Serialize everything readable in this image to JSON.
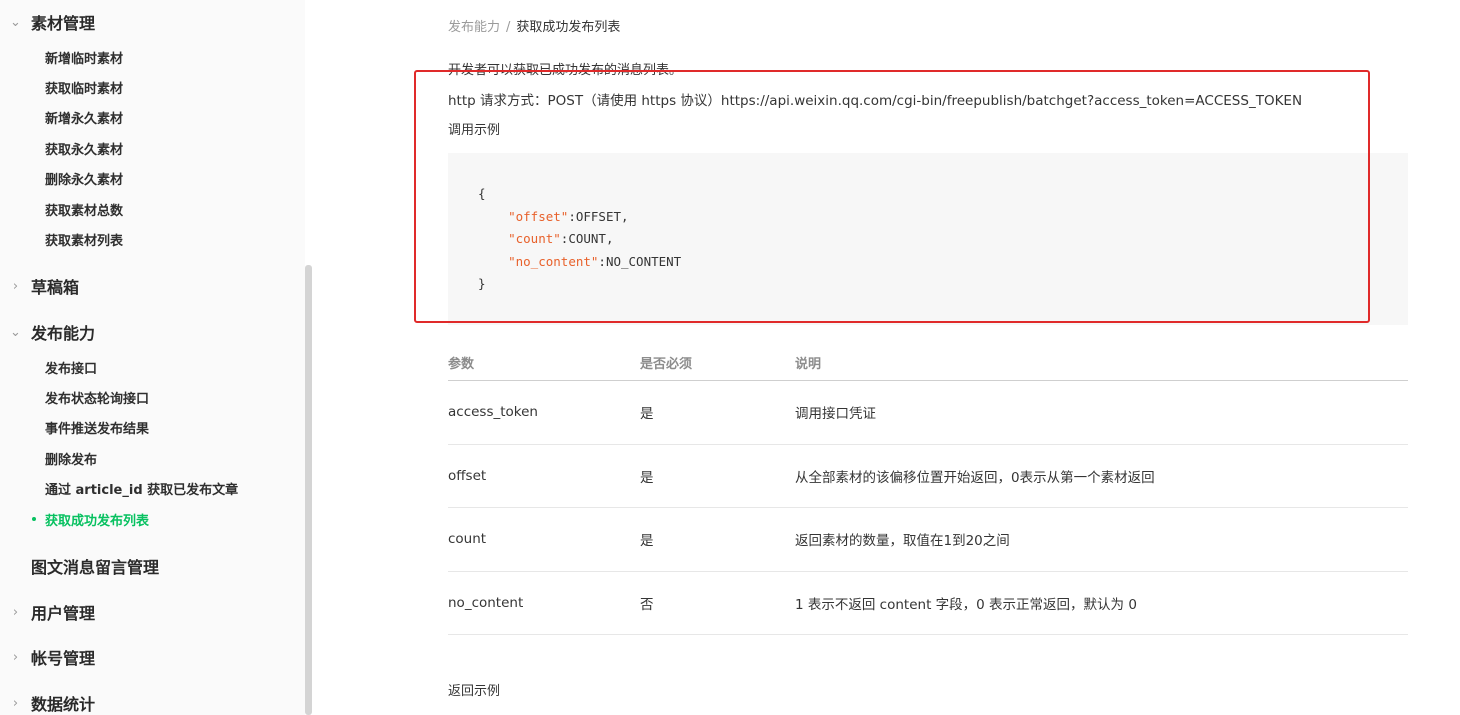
{
  "sidebar": {
    "groups": [
      {
        "title": "素材管理",
        "arrow": "⌄",
        "items": [
          "新增临时素材",
          "获取临时素材",
          "新增永久素材",
          "获取永久素材",
          "删除永久素材",
          "获取素材总数",
          "获取素材列表"
        ]
      },
      {
        "title": "草稿箱",
        "arrow": "›"
      },
      {
        "title": "发布能力",
        "arrow": "⌄",
        "items": [
          "发布接口",
          "发布状态轮询接口",
          "事件推送发布结果",
          "删除发布",
          "通过 article_id 获取已发布文章",
          "获取成功发布列表"
        ],
        "active_item": "获取成功发布列表"
      },
      {
        "title": "图文消息留言管理",
        "arrow": ""
      },
      {
        "title": "用户管理",
        "arrow": "›"
      },
      {
        "title": "帐号管理",
        "arrow": "›"
      },
      {
        "title": "数据统计",
        "arrow": "›"
      }
    ]
  },
  "main": {
    "breadcrumb": {
      "parent": "发布能力",
      "separator": "/",
      "current": "获取成功发布列表"
    },
    "description": "开发者可以获取已成功发布的消息列表。",
    "http_line": "http 请求方式：POST（请使用 https 协议）https://api.weixin.qq.com/cgi-bin/freepublish/batchget?access_token=ACCESS_TOKEN",
    "sample_label": "调用示例",
    "code": {
      "open": "{",
      "lines": [
        {
          "key": "\"offset\"",
          "value": ":OFFSET,"
        },
        {
          "key": "\"count\"",
          "value": ":COUNT,"
        },
        {
          "key": "\"no_content\"",
          "value": ":NO_CONTENT"
        }
      ],
      "close": "}"
    },
    "table": {
      "headers": [
        "参数",
        "是否必须",
        "说明"
      ],
      "rows": [
        [
          "access_token",
          "是",
          "调用接口凭证"
        ],
        [
          "offset",
          "是",
          "从全部素材的该偏移位置开始返回，0表示从第一个素材返回"
        ],
        [
          "count",
          "是",
          "返回素材的数量，取值在1到20之间"
        ],
        [
          "no_content",
          "否",
          "1 表示不返回 content 字段，0 表示正常返回，默认为 0"
        ]
      ]
    },
    "return_label": "返回示例"
  },
  "colors": {
    "accent": "#07c160",
    "highlight_border": "#e02a2a",
    "code_key": "#e8612b",
    "code_bg": "#f7f7f7"
  }
}
